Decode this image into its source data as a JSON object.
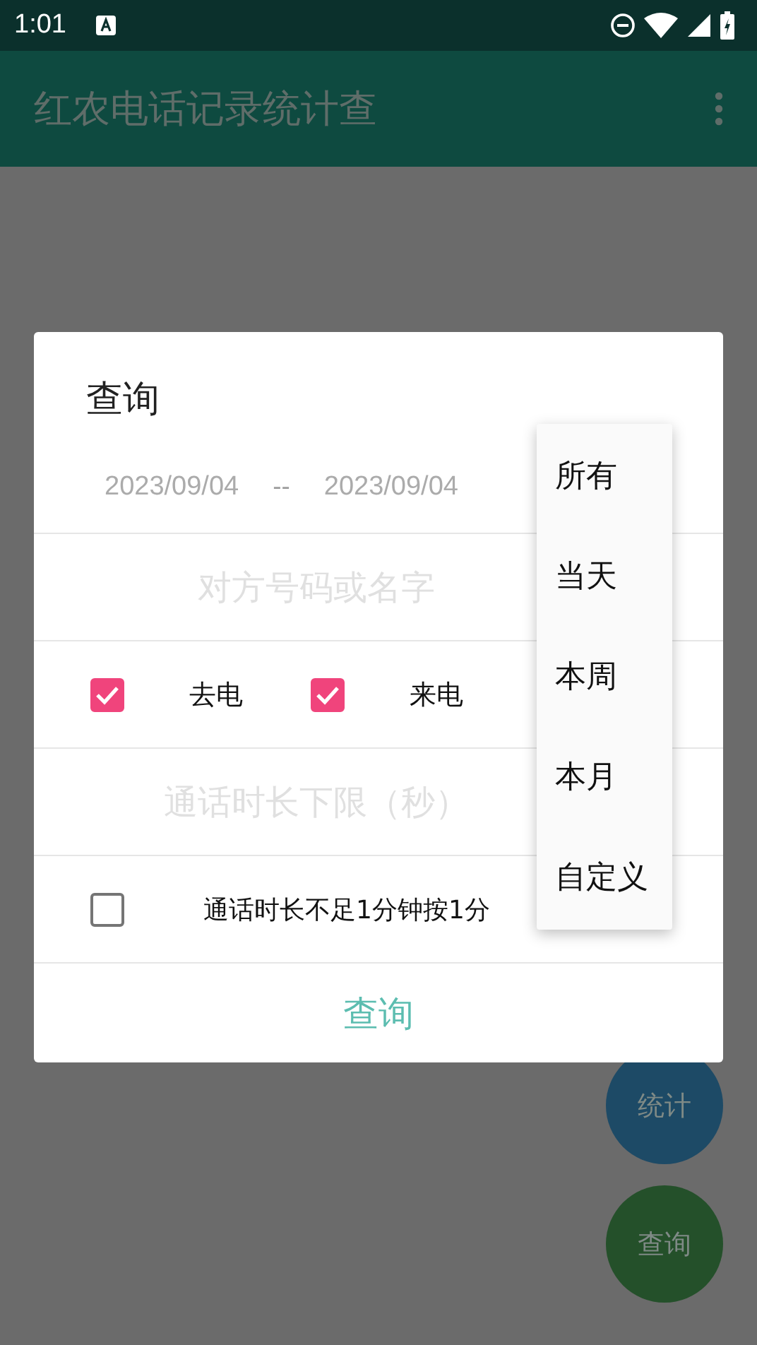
{
  "status_bar": {
    "time": "1:01"
  },
  "app_bar": {
    "title": "红农电话记录统计查"
  },
  "fabs": [
    {
      "label": "统计",
      "color": "#1d4a66"
    },
    {
      "label": "查询",
      "color": "#24502a"
    }
  ],
  "dialog": {
    "title": "查询",
    "date_from": "2023/09/04",
    "date_separator": "--",
    "date_to": "2023/09/04",
    "contact_field": {
      "placeholder": "对方号码或名字"
    },
    "call_types": [
      {
        "label": "去电",
        "checked": true
      },
      {
        "label": "来电",
        "checked": true
      }
    ],
    "duration_field": {
      "placeholder": "通话时长下限（秒）"
    },
    "round_up": {
      "label": "通话时长不足1分钟按1分",
      "checked": false
    },
    "button": "查询"
  },
  "menu": [
    {
      "label": "所有"
    },
    {
      "label": "当天"
    },
    {
      "label": "本周"
    },
    {
      "label": "本月"
    },
    {
      "label": "自定义"
    }
  ]
}
